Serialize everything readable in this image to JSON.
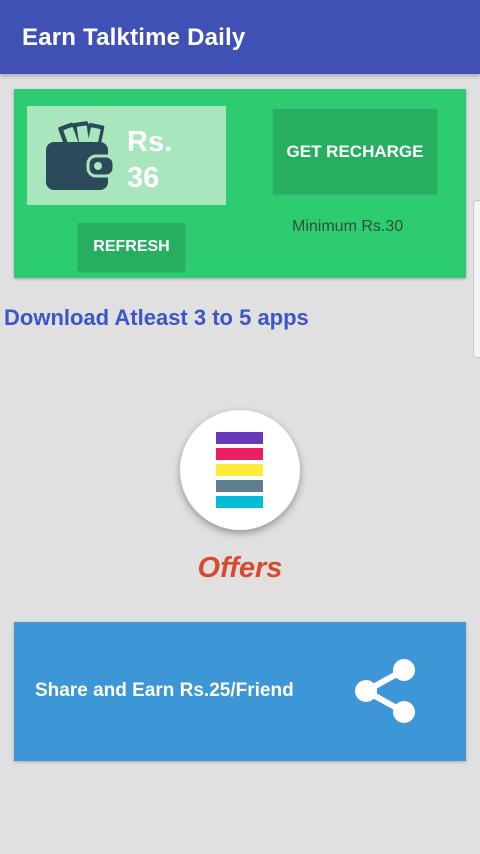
{
  "app_bar": {
    "title": "Earn Talktime Daily",
    "color": "#3f51b5"
  },
  "wallet": {
    "icon": "wallet-icon",
    "balance_label": "Rs.",
    "balance_amount": "36",
    "get_recharge_label": "GET RECHARGE",
    "refresh_label": "REFRESH",
    "minimum_text": "Minimum Rs.30",
    "card_color": "#2ecc71"
  },
  "download_text": "Download Atleast 3 to 5 apps",
  "offers": {
    "icon": "offers-stack-icon",
    "label": "Offers",
    "stripe_colors": [
      "#673ab7",
      "#e91e63",
      "#ffeb3b",
      "#607d8b",
      "#00bcd4"
    ]
  },
  "share": {
    "label": "Share and Earn Rs.25/Friend",
    "icon": "share-icon",
    "card_color": "#3d96d6"
  }
}
